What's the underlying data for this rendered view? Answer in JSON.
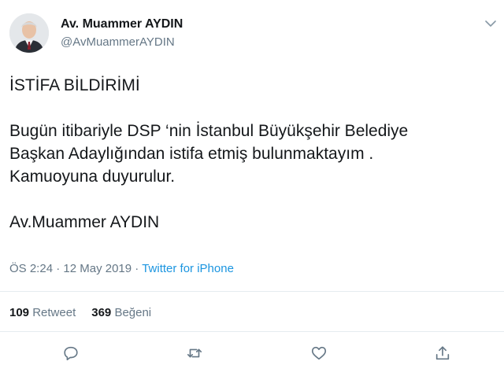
{
  "author": {
    "name": "Av. Muammer AYDIN",
    "handle": "@AvMuammerAYDIN"
  },
  "tweet": {
    "title_line": "İSTİFA BİLDİRİMİ",
    "line1": "Bugün itibariyle DSP ‘nin İstanbul Büyükşehir Belediye",
    "line2": "Başkan Adaylığından istifa etmiş bulunmaktayım .",
    "line3": "Kamuoyuna duyurulur.",
    "signature": "Av.Muammer AYDIN"
  },
  "meta": {
    "time": "ÖS 2:24",
    "separator1": " · ",
    "date": "12 May 2019",
    "separator2": " · ",
    "source": "Twitter for iPhone"
  },
  "stats": {
    "retweet_count": "109",
    "retweet_label": "Retweet",
    "like_count": "369",
    "like_label": "Beğeni"
  },
  "actions": {
    "reply_icon": "reply-icon",
    "retweet_icon": "retweet-icon",
    "like_icon": "heart-icon",
    "share_icon": "share-icon"
  },
  "colors": {
    "text": "#14171a",
    "secondary": "#657786",
    "link": "#1b95e0",
    "divider": "#e6ecf0"
  }
}
